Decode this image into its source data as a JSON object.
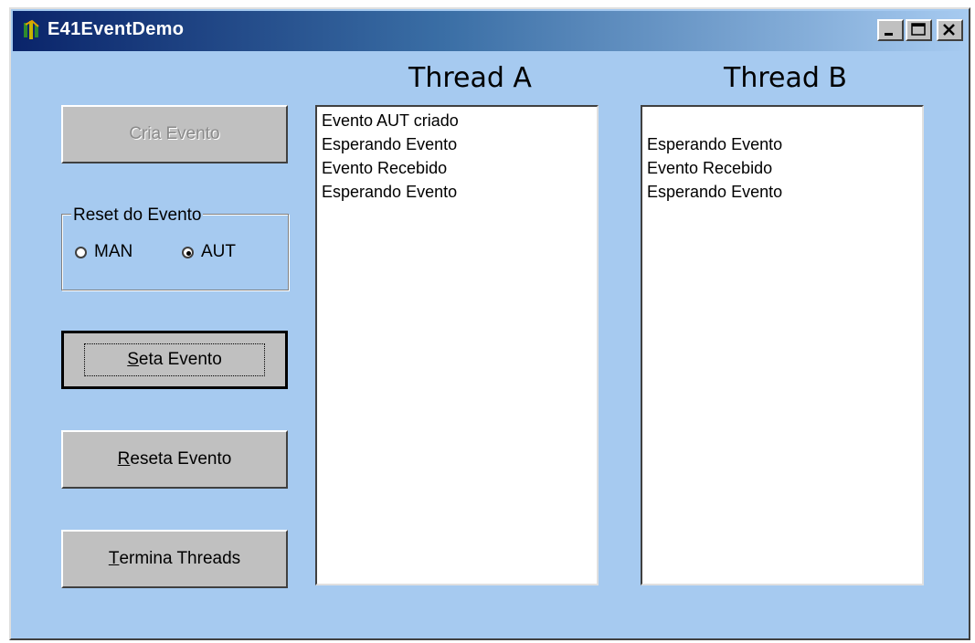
{
  "window": {
    "title": "E41EventDemo",
    "controls": [
      "minimize",
      "maximize",
      "close"
    ]
  },
  "buttons": {
    "cria_evento": "Cria Evento",
    "seta_evento": {
      "before": "",
      "underline": "S",
      "after": "eta Evento"
    },
    "reseta_evento": {
      "before": "",
      "underline": "R",
      "after": "eseta Evento"
    },
    "termina_threads": {
      "before": "",
      "underline": "T",
      "after": "ermina Threads"
    }
  },
  "reset_group": {
    "label": "Reset do Evento",
    "options": [
      {
        "label": "MAN",
        "selected": false
      },
      {
        "label": "AUT",
        "selected": true
      }
    ]
  },
  "thread_a": {
    "title": "Thread A",
    "lines": [
      "Evento AUT criado",
      "Esperando Evento",
      "Evento Recebido",
      "Esperando Evento"
    ]
  },
  "thread_b": {
    "title": "Thread B",
    "lines": [
      "",
      "Esperando Evento",
      "Evento Recebido",
      "Esperando Evento"
    ]
  },
  "colors": {
    "client_bg": "#a6caf0",
    "titlebar_start": "#0a246a",
    "button_face": "#c0c0c0"
  }
}
